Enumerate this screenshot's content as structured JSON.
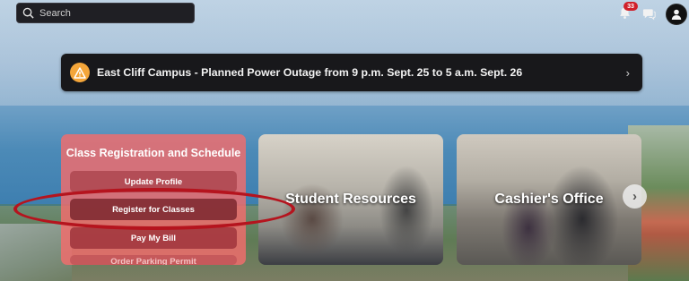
{
  "header": {
    "search_placeholder": "Search",
    "notification_count": "33",
    "icons": [
      "search-icon",
      "bell-icon",
      "chat-icon",
      "user-avatar-icon"
    ]
  },
  "alert": {
    "text": "East Cliff Campus - Planned Power Outage from 9 p.m. Sept. 25 to 5 a.m. Sept. 26",
    "chevron": "›"
  },
  "registration": {
    "title": "Class Registration and Schedule",
    "buttons": [
      "Update Profile",
      "Register for Classes",
      "Pay My Bill",
      "Order Parking Permit"
    ]
  },
  "cards": {
    "student_resources": "Student Resources",
    "cashiers_office": "Cashier's Office",
    "next_arrow": "›"
  },
  "colors": {
    "accent_card": "#f36c6c",
    "alert_bg": "#18181b",
    "warning": "#f4a63a",
    "annotation": "#b5141e",
    "badge": "#d0202a"
  }
}
